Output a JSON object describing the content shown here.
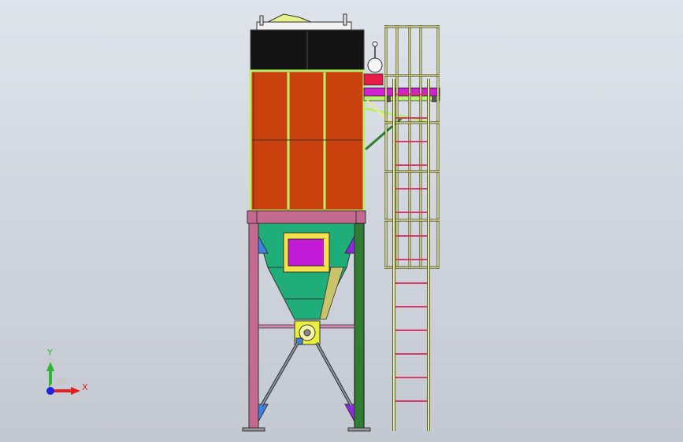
{
  "viewport": {
    "background_top": "#dfe3ea",
    "background_bottom": "#c3c8d1"
  },
  "model": {
    "colors": {
      "housing_top": "#141414",
      "filter_panel": "#c8410f",
      "frame_green": "#b7f26a",
      "support_leg_left": "#c46a8f",
      "support_leg_right": "#2e7d32",
      "hopper": "#1fae7a",
      "hopper_door": "#c21ad6",
      "hopper_door_frame": "#f4e24a",
      "ladder": "#e9ef7a",
      "ladder_rung": "#d63a6a",
      "platform": "#d31fd3",
      "rotary_valve": "#e9ef3a",
      "gusset_blue": "#3b82e6",
      "gusset_purple": "#8a2be2"
    }
  },
  "triad": {
    "y_label": "Y",
    "x_label": "X",
    "y_color": "#2fb82f",
    "x_color": "#e02020",
    "z_color": "#2020e0"
  }
}
